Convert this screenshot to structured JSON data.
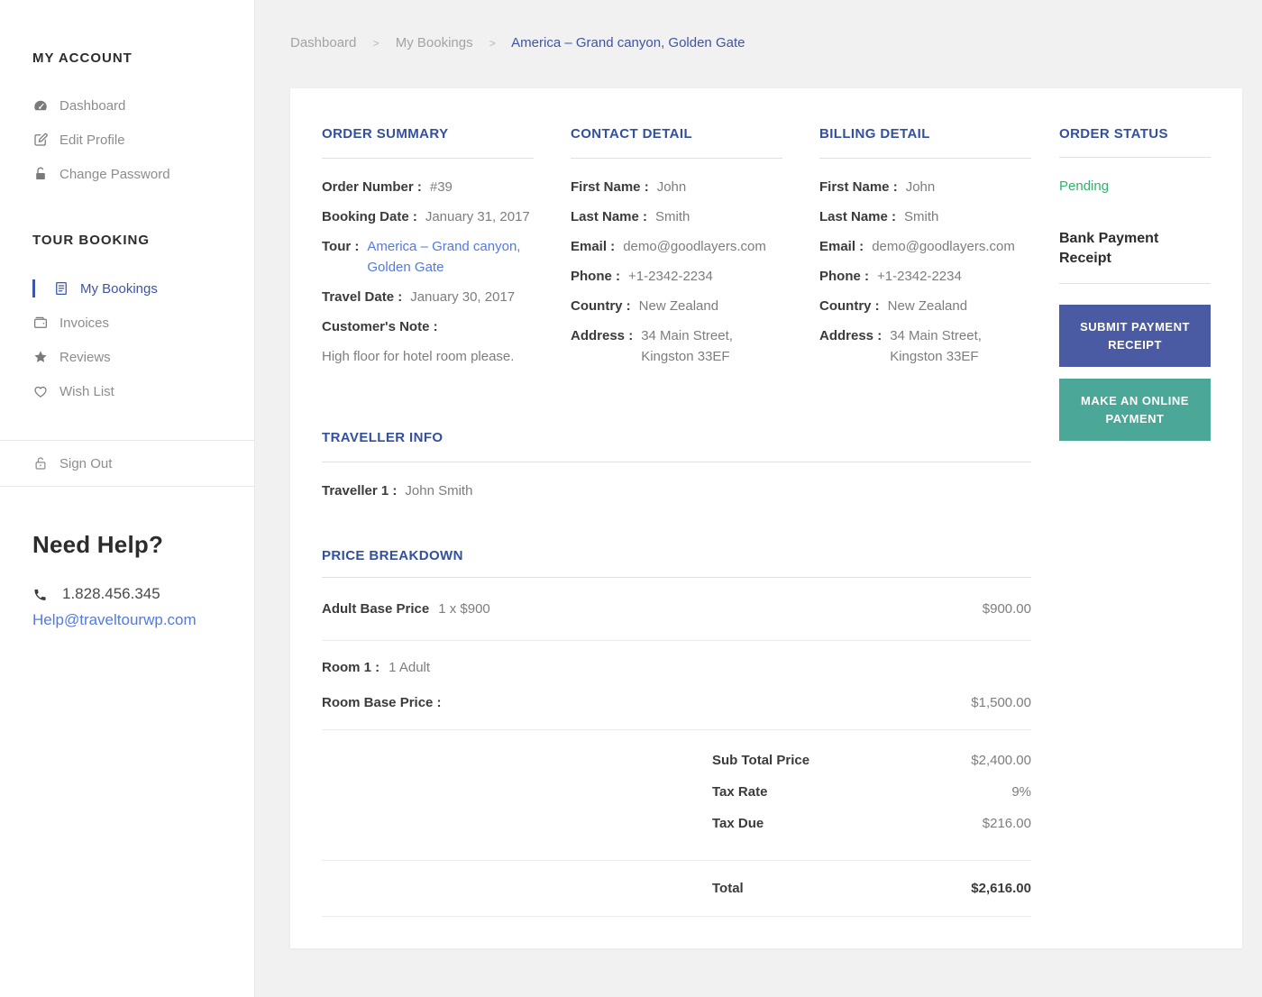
{
  "colors": {
    "accent_indigo": "#33509f",
    "link_blue": "#5379e3",
    "status_green": "#2fb36a",
    "button_indigo": "#4a5ba3",
    "button_teal": "#4ba797",
    "page_background": "#f1f1f2"
  },
  "sidebar": {
    "sections": [
      {
        "heading": "MY ACCOUNT",
        "items": [
          {
            "label": "Dashboard",
            "icon": "dashboard-gauge-icon"
          },
          {
            "label": "Edit Profile",
            "icon": "edit-pencil-icon"
          },
          {
            "label": "Change Password",
            "icon": "lock-icon"
          }
        ]
      },
      {
        "heading": "TOUR BOOKING",
        "items": [
          {
            "label": "My Bookings",
            "icon": "bookings-document-icon",
            "active": true
          },
          {
            "label": "Invoices",
            "icon": "wallet-icon"
          },
          {
            "label": "Reviews",
            "icon": "star-icon"
          },
          {
            "label": "Wish List",
            "icon": "heart-icon"
          }
        ]
      }
    ],
    "sign_out": {
      "label": "Sign Out",
      "icon": "unlock-icon"
    },
    "help": {
      "heading": "Need Help?",
      "phone": "1.828.456.345",
      "email": "Help@traveltourwp.com"
    }
  },
  "breadcrumb": {
    "separator": ">",
    "items": [
      {
        "label": "Dashboard"
      },
      {
        "label": "My Bookings"
      },
      {
        "label": "America – Grand canyon, Golden Gate",
        "current": true
      }
    ]
  },
  "order_summary": {
    "heading": "ORDER SUMMARY",
    "fields": [
      {
        "label": "Order Number :",
        "value": "#39"
      },
      {
        "label": "Booking Date :",
        "value": "January 31, 2017"
      },
      {
        "label": "Tour :",
        "value": "America – Grand canyon, Golden Gate",
        "is_link": true
      },
      {
        "label": "Travel Date :",
        "value": "January 30, 2017"
      }
    ],
    "note_label": "Customer's Note :",
    "note_value": "High floor for hotel room please."
  },
  "contact_detail": {
    "heading": "CONTACT DETAIL",
    "fields": [
      {
        "label": "First Name :",
        "value": "John"
      },
      {
        "label": "Last Name :",
        "value": "Smith"
      },
      {
        "label": "Email :",
        "value": "demo@goodlayers.com"
      },
      {
        "label": "Phone :",
        "value": "+1-2342-2234"
      },
      {
        "label": "Country :",
        "value": "New Zealand"
      },
      {
        "label": "Address :",
        "value": "34 Main Street, Kingston 33EF"
      }
    ]
  },
  "billing_detail": {
    "heading": "BILLING DETAIL",
    "fields": [
      {
        "label": "First Name :",
        "value": "John"
      },
      {
        "label": "Last Name :",
        "value": "Smith"
      },
      {
        "label": "Email :",
        "value": "demo@goodlayers.com"
      },
      {
        "label": "Phone :",
        "value": "+1-2342-2234"
      },
      {
        "label": "Country :",
        "value": "New Zealand"
      },
      {
        "label": "Address :",
        "value": "34 Main Street, Kingston 33EF"
      }
    ]
  },
  "order_status": {
    "heading": "ORDER STATUS",
    "status": "Pending",
    "receipt_heading": "Bank Payment Receipt",
    "buttons": [
      {
        "label": "SUBMIT PAYMENT RECEIPT",
        "color": "#4a5ba3"
      },
      {
        "label": "MAKE AN ONLINE PAYMENT",
        "color": "#4ba797"
      }
    ]
  },
  "traveller_info": {
    "heading": "TRAVELLER INFO",
    "rows": [
      {
        "label": "Traveller 1 :",
        "value": "John Smith"
      }
    ]
  },
  "price_breakdown": {
    "heading": "PRICE BREAKDOWN",
    "adult_row": {
      "label": "Adult Base Price",
      "detail": "1 x $900",
      "amount": "$900.00"
    },
    "room_row": {
      "label": "Room 1 :",
      "detail": "1 Adult"
    },
    "room_base_row": {
      "label": "Room Base Price :",
      "amount": "$1,500.00"
    },
    "summary_rows": [
      {
        "label": "Sub Total Price",
        "amount": "$2,400.00"
      },
      {
        "label": "Tax Rate",
        "amount": "9%"
      },
      {
        "label": "Tax Due",
        "amount": "$216.00"
      }
    ],
    "total_row": {
      "label": "Total",
      "amount": "$2,616.00"
    }
  }
}
